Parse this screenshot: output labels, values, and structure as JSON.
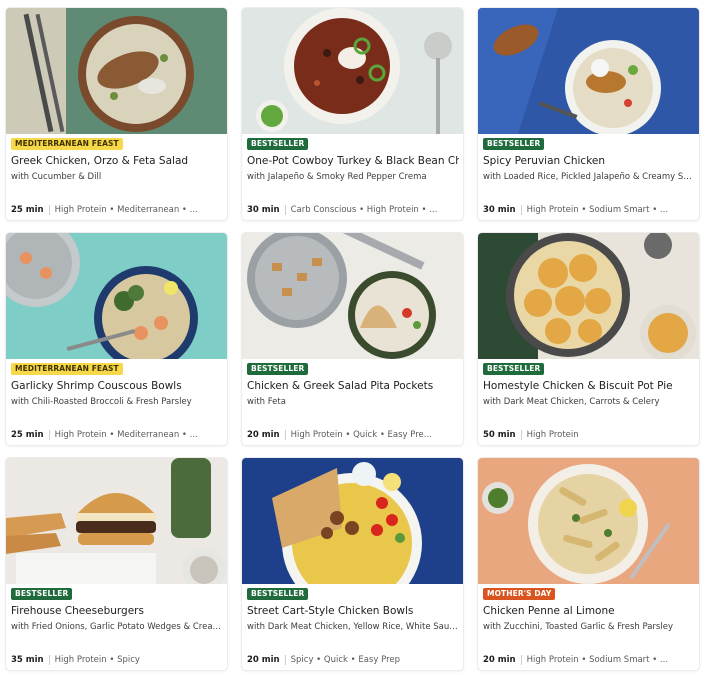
{
  "recipes": [
    {
      "badge": "MEDITERRANEAN FEAST",
      "badge_type": "feast",
      "title": "Greek Chicken, Orzo & Feta Salad",
      "subtitle": "with Cucumber & Dill",
      "time": "25 min",
      "tags": "High Protein • Mediterranean • ...",
      "image_icon": "greek-chicken-orzo-image"
    },
    {
      "badge": "BESTSELLER",
      "badge_type": "best",
      "title": "One-Pot Cowboy Turkey & Black Bean Chili",
      "subtitle": "with Jalapeño & Smoky Red Pepper Crema",
      "time": "30 min",
      "tags": "Carb Conscious • High Protein • ...",
      "image_icon": "turkey-chili-image"
    },
    {
      "badge": "BESTSELLER",
      "badge_type": "best",
      "title": "Spicy Peruvian Chicken",
      "subtitle": "with Loaded Rice, Pickled Jalapeño & Creamy Salsa...",
      "time": "30 min",
      "tags": "High Protein • Sodium Smart • ...",
      "image_icon": "peruvian-chicken-image"
    },
    {
      "badge": "MEDITERRANEAN FEAST",
      "badge_type": "feast",
      "title": "Garlicky Shrimp Couscous Bowls",
      "subtitle": "with Chili-Roasted Broccoli & Fresh Parsley",
      "time": "25 min",
      "tags": "High Protein • Mediterranean • ...",
      "image_icon": "shrimp-couscous-image"
    },
    {
      "badge": "BESTSELLER",
      "badge_type": "best",
      "title": "Chicken & Greek Salad Pita Pockets",
      "subtitle": "with Feta",
      "time": "20 min",
      "tags": "High Protein • Quick • Easy Pre...",
      "image_icon": "pita-pockets-image"
    },
    {
      "badge": "BESTSELLER",
      "badge_type": "best",
      "title": "Homestyle Chicken & Biscuit Pot Pie",
      "subtitle": "with Dark Meat Chicken, Carrots & Celery",
      "time": "50 min",
      "tags": "High Protein",
      "image_icon": "pot-pie-image"
    },
    {
      "badge": "BESTSELLER",
      "badge_type": "best",
      "title": "Firehouse Cheeseburgers",
      "subtitle": "with Fried Onions, Garlic Potato Wedges & Creamy ...",
      "time": "35 min",
      "tags": "High Protein • Spicy",
      "image_icon": "cheeseburger-image"
    },
    {
      "badge": "BESTSELLER",
      "badge_type": "best",
      "title": "Street Cart-Style Chicken Bowls",
      "subtitle": "with Dark Meat Chicken, Yellow Rice, White Sauce ...",
      "time": "20 min",
      "tags": "Spicy • Quick • Easy Prep",
      "image_icon": "chicken-bowls-image"
    },
    {
      "badge": "MOTHER'S DAY",
      "badge_type": "mothers",
      "title": "Chicken Penne al Limone",
      "subtitle": "with Zucchini, Toasted Garlic & Fresh Parsley",
      "time": "20 min",
      "tags": "High Protein • Sodium Smart • ...",
      "image_icon": "penne-limone-image"
    }
  ],
  "colors": {
    "bestseller": "#1f6b3b",
    "feast": "#f7d84a",
    "mothers_day": "#d9541e"
  }
}
